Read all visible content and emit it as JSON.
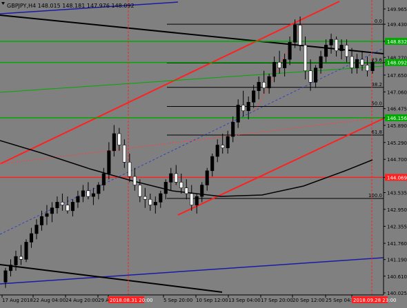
{
  "chart_data": {
    "type": "candlestick",
    "title": "GBPJPY,H4  148.015 148.181 147.976 148.092",
    "symbol": "GBPJPY",
    "timeframe": "H4",
    "quote": {
      "open": 148.015,
      "high": 148.181,
      "low": 147.976,
      "close": 148.092
    },
    "ylim": [
      140.0,
      150.2
    ],
    "price_ticks": [
      149.965,
      149.43,
      148.832,
      148.27,
      148.092,
      147.65,
      147.06,
      146.475,
      146.156,
      145.89,
      145.29,
      144.7,
      144.069,
      143.535,
      142.95,
      142.355,
      141.76,
      141.19,
      140.61,
      140.025
    ],
    "time_ticks": [
      "17 Aug 2018",
      "22 Aug 04:00",
      "24 Aug 20:00",
      "29 A",
      "2018.08.31 20:00",
      "5 Sep 20:00",
      "10 Sep 12:00",
      "13 Sep 04:00",
      "17 Sep 20:00",
      "20 Sep 12:00",
      "25 Sep 04:00",
      "2018.09.28 23:00"
    ],
    "highlight_time_labels": [
      "2018.08.31 20:00",
      "2018.09.28 23:00"
    ],
    "highlight_price_labels": [
      "148.832",
      "148.092",
      "146.156",
      "144.069"
    ],
    "fibonacci_levels": [
      {
        "label": "0.0",
        "price": 149.43
      },
      {
        "label": "23.6",
        "price": 148.07
      },
      {
        "label": "38.2",
        "price": 147.22
      },
      {
        "label": "50.0",
        "price": 146.55
      },
      {
        "label": "61.8",
        "price": 145.55
      },
      {
        "label": "100.0",
        "price": 143.33
      }
    ],
    "candles": [
      [
        140.4,
        140.9,
        140.2,
        140.8
      ],
      [
        140.8,
        141.2,
        140.6,
        141.0
      ],
      [
        141.0,
        141.5,
        140.8,
        141.3
      ],
      [
        141.3,
        141.7,
        141.0,
        141.2
      ],
      [
        141.2,
        141.9,
        141.1,
        141.8
      ],
      [
        141.8,
        142.3,
        141.6,
        142.1
      ],
      [
        142.1,
        142.6,
        141.9,
        142.4
      ],
      [
        142.4,
        142.9,
        142.2,
        142.7
      ],
      [
        142.7,
        143.1,
        142.4,
        142.8
      ],
      [
        142.8,
        143.2,
        142.5,
        143.0
      ],
      [
        143.0,
        143.4,
        142.8,
        143.2
      ],
      [
        143.2,
        143.5,
        142.9,
        143.1
      ],
      [
        143.1,
        143.4,
        142.8,
        142.9
      ],
      [
        142.9,
        143.3,
        142.7,
        143.2
      ],
      [
        143.2,
        143.6,
        143.0,
        143.4
      ],
      [
        143.4,
        143.8,
        143.2,
        143.6
      ],
      [
        143.6,
        143.9,
        143.3,
        143.4
      ],
      [
        143.4,
        143.7,
        143.1,
        143.5
      ],
      [
        143.5,
        143.9,
        143.3,
        143.8
      ],
      [
        143.8,
        144.4,
        143.6,
        144.2
      ],
      [
        144.2,
        145.3,
        144.0,
        145.0
      ],
      [
        145.0,
        145.9,
        144.8,
        145.6
      ],
      [
        145.6,
        145.8,
        145.0,
        145.2
      ],
      [
        145.2,
        145.4,
        144.4,
        144.6
      ],
      [
        144.6,
        144.9,
        143.9,
        144.1
      ],
      [
        144.1,
        144.4,
        143.6,
        143.8
      ],
      [
        143.8,
        144.0,
        143.2,
        143.4
      ],
      [
        143.4,
        143.7,
        143.0,
        143.3
      ],
      [
        143.3,
        143.5,
        142.9,
        143.1
      ],
      [
        143.1,
        143.4,
        142.8,
        143.2
      ],
      [
        143.2,
        143.6,
        143.0,
        143.5
      ],
      [
        143.5,
        144.0,
        143.3,
        143.9
      ],
      [
        143.9,
        144.4,
        143.6,
        144.2
      ],
      [
        144.2,
        144.5,
        143.8,
        143.9
      ],
      [
        143.9,
        144.2,
        143.5,
        143.7
      ],
      [
        143.7,
        144.0,
        143.3,
        143.5
      ],
      [
        143.5,
        143.8,
        142.9,
        143.1
      ],
      [
        143.1,
        143.5,
        142.8,
        143.4
      ],
      [
        143.4,
        143.9,
        143.2,
        143.8
      ],
      [
        143.8,
        144.4,
        143.6,
        144.3
      ],
      [
        144.3,
        144.9,
        144.1,
        144.8
      ],
      [
        144.8,
        145.4,
        144.6,
        145.2
      ],
      [
        145.2,
        145.6,
        144.9,
        145.1
      ],
      [
        145.1,
        145.7,
        144.9,
        145.5
      ],
      [
        145.5,
        146.2,
        145.3,
        146.0
      ],
      [
        146.0,
        146.8,
        145.8,
        146.6
      ],
      [
        146.6,
        147.1,
        146.2,
        146.4
      ],
      [
        146.4,
        146.9,
        146.1,
        146.7
      ],
      [
        146.7,
        147.3,
        146.5,
        147.1
      ],
      [
        147.1,
        147.6,
        146.8,
        147.4
      ],
      [
        147.4,
        147.8,
        147.0,
        147.2
      ],
      [
        147.2,
        147.7,
        147.0,
        147.6
      ],
      [
        147.6,
        148.3,
        147.4,
        148.1
      ],
      [
        148.1,
        148.5,
        147.7,
        147.9
      ],
      [
        147.9,
        148.4,
        147.6,
        148.2
      ],
      [
        148.2,
        149.0,
        148.0,
        148.8
      ],
      [
        148.8,
        149.6,
        148.6,
        149.4
      ],
      [
        149.4,
        149.7,
        148.5,
        148.7
      ],
      [
        148.7,
        149.0,
        147.5,
        147.8
      ],
      [
        147.8,
        148.2,
        147.1,
        147.4
      ],
      [
        147.4,
        148.0,
        147.2,
        147.9
      ],
      [
        147.9,
        148.5,
        147.7,
        148.3
      ],
      [
        148.3,
        148.9,
        148.1,
        148.7
      ],
      [
        148.7,
        149.1,
        148.4,
        148.9
      ],
      [
        148.9,
        149.0,
        148.3,
        148.5
      ],
      [
        148.5,
        148.9,
        148.2,
        148.7
      ],
      [
        148.7,
        148.9,
        148.1,
        148.3
      ],
      [
        148.3,
        148.6,
        147.7,
        147.9
      ],
      [
        147.9,
        148.4,
        147.7,
        148.2
      ],
      [
        148.2,
        148.5,
        147.8,
        148.0
      ],
      [
        148.0,
        148.3,
        147.6,
        147.8
      ],
      [
        147.8,
        148.2,
        147.7,
        148.1
      ]
    ]
  }
}
